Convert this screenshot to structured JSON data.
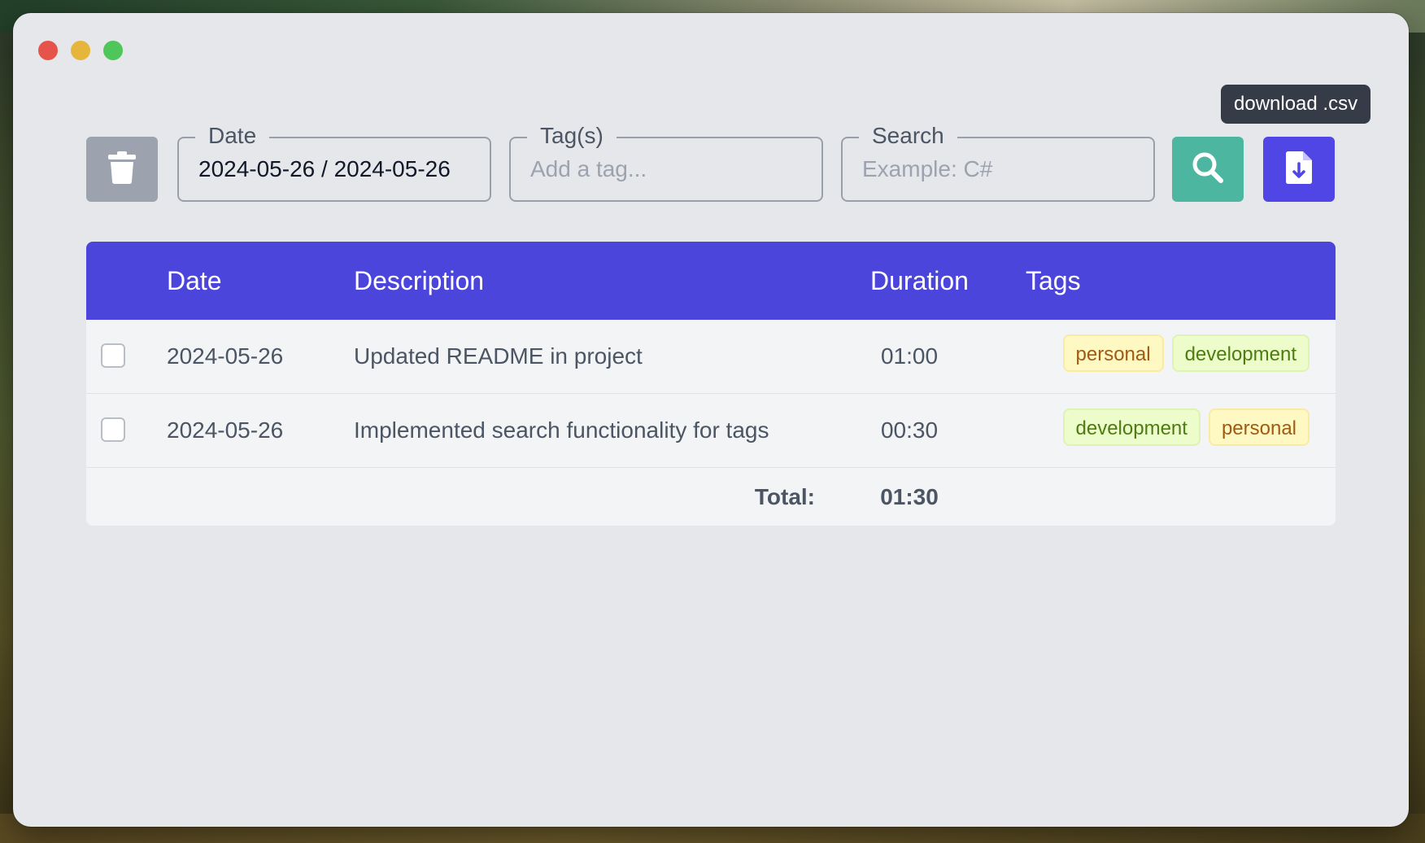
{
  "window": {
    "controls": [
      "close",
      "minimize",
      "maximize"
    ]
  },
  "tooltip": {
    "text": "download .csv"
  },
  "filters": {
    "date": {
      "label": "Date",
      "value": "2024-05-26 / 2024-05-26"
    },
    "tags": {
      "label": "Tag(s)",
      "placeholder": "Add a tag..."
    },
    "search": {
      "label": "Search",
      "placeholder": "Example: C#"
    }
  },
  "toolbar": {
    "delete_icon": "trash-icon",
    "search_icon": "search-icon",
    "download_icon": "file-download-icon"
  },
  "table": {
    "headers": {
      "date": "Date",
      "description": "Description",
      "duration": "Duration",
      "tags": "Tags"
    },
    "rows": [
      {
        "date": "2024-05-26",
        "description": "Updated README in project",
        "duration": "01:00",
        "tags": [
          "personal",
          "development"
        ]
      },
      {
        "date": "2024-05-26",
        "description": "Implemented search functionality for tags",
        "duration": "00:30",
        "tags": [
          "development",
          "personal"
        ]
      }
    ],
    "total": {
      "label": "Total:",
      "value": "01:30"
    }
  },
  "colors": {
    "accent": "#4b45dc",
    "search_button": "#4db6a0",
    "download_button": "#4f46e5",
    "delete_button": "#9ca3af",
    "tag_personal_bg": "#fef9c3",
    "tag_personal_text": "#a05a12",
    "tag_development_bg": "#ecfccb",
    "tag_development_text": "#4d7c0f"
  }
}
